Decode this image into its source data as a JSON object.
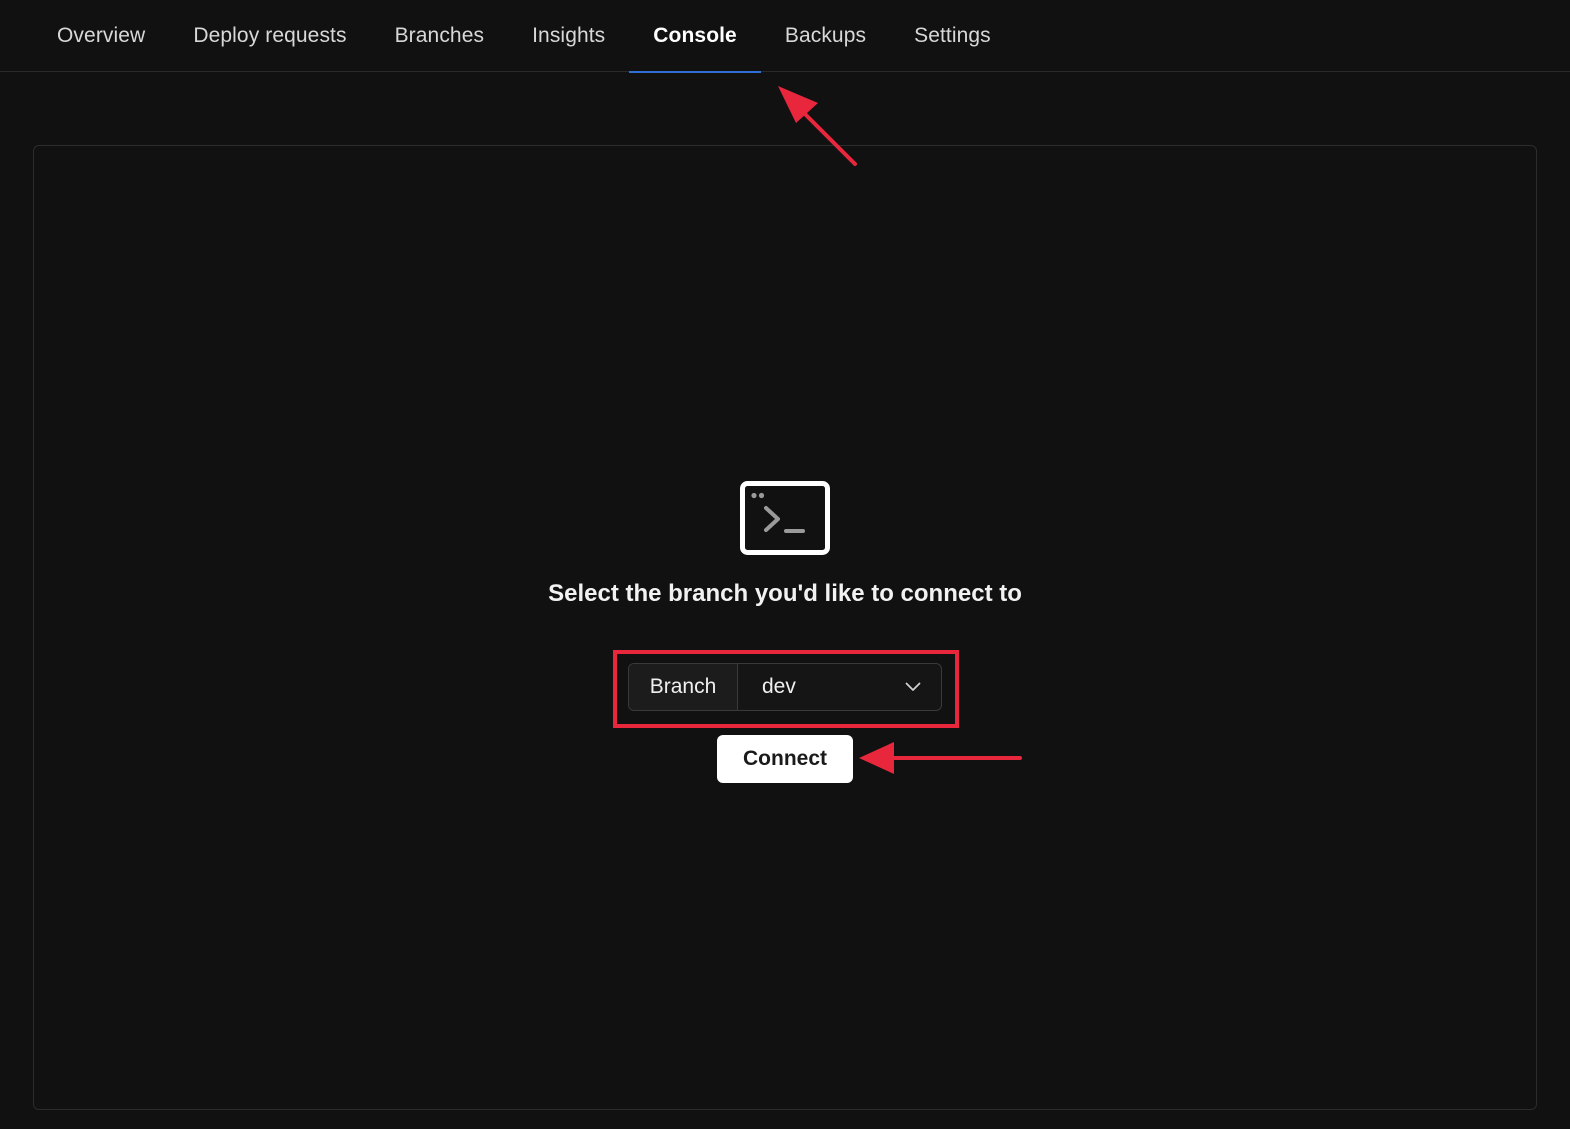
{
  "nav": {
    "tabs": [
      {
        "label": "Overview"
      },
      {
        "label": "Deploy requests"
      },
      {
        "label": "Branches"
      },
      {
        "label": "Insights"
      },
      {
        "label": "Console",
        "active": true
      },
      {
        "label": "Backups"
      },
      {
        "label": "Settings"
      }
    ],
    "active_tab": "Console"
  },
  "console": {
    "icon": "terminal-icon",
    "heading": "Select the branch you'd like to connect to",
    "branch_label": "Branch",
    "branch_value": "dev",
    "connect_label": "Connect"
  },
  "colors": {
    "background": "#111111",
    "active_tab_underline": "#2f6fd6",
    "annotation": "#e8273d",
    "button_bg": "#ffffff"
  }
}
